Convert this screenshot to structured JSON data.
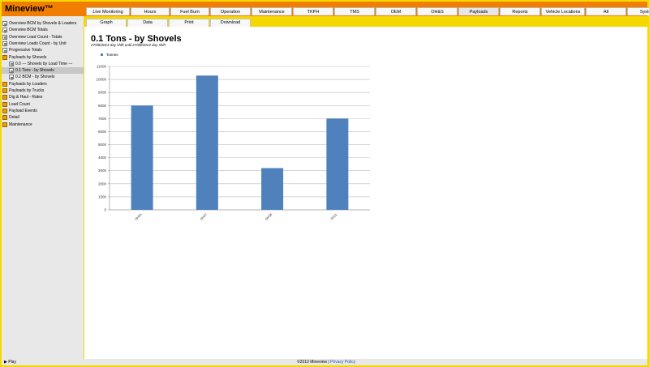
{
  "app": {
    "title": "Mineview™"
  },
  "tabs": [
    "Live Monitoring",
    "Hours",
    "Fuel Burn",
    "Operation",
    "Maintenance",
    "TKPH",
    "TMS",
    "OEM",
    "OH&S",
    "Payloads",
    "Reports",
    "Vehicle Locations",
    "All",
    "System"
  ],
  "active_tab": "Payloads",
  "subtabs": [
    "Graph",
    "Data",
    "Print",
    "Download"
  ],
  "sidebar": {
    "items": [
      {
        "label": "Overview BCM by Shovels & Loaders",
        "icon": "document-icon",
        "indent": 0
      },
      {
        "label": "Overview BCM Totals",
        "icon": "document-icon",
        "indent": 0
      },
      {
        "label": "Overview Load Count - Totals",
        "icon": "document-icon",
        "indent": 0
      },
      {
        "label": "Overview Loads Count - by Unit",
        "icon": "document-icon",
        "indent": 0
      },
      {
        "label": "Progressive Totals",
        "icon": "document-icon",
        "indent": 0
      },
      {
        "label": "Payloads by Shovels",
        "icon": "folder-icon",
        "indent": 0
      },
      {
        "label": "0.0 --- Shovels by Load Time ---",
        "icon": "document-icon",
        "indent": 1
      },
      {
        "label": "0.1 Tons - by Shovels",
        "icon": "document-icon",
        "indent": 1
      },
      {
        "label": "0.2 BCM - by Shovels",
        "icon": "document-icon",
        "indent": 1
      },
      {
        "label": "Payloads by Loaders",
        "icon": "folder-icon",
        "indent": 0
      },
      {
        "label": "Payloads by Trucks",
        "icon": "folder-icon",
        "indent": 0
      },
      {
        "label": "Dig & Haul - Rates",
        "icon": "folder-icon",
        "indent": 0
      },
      {
        "label": "Load Count",
        "icon": "folder-icon",
        "indent": 0
      },
      {
        "label": "Payload Events",
        "icon": "folder-icon",
        "indent": 0
      },
      {
        "label": "Detail",
        "icon": "folder-icon",
        "indent": 0
      },
      {
        "label": "Maintenance",
        "icon": "folder-icon",
        "indent": 0
      }
    ],
    "selected": "0.1 Tons - by Shovels"
  },
  "page": {
    "title": "0.1 Tons - by Shovels",
    "subtitle": "27/08/2014 day shift until 27/08/2014 day shift"
  },
  "colors": {
    "bar": "#4f81bd",
    "header": "#f17e00",
    "frame": "#f5d800"
  },
  "chart_data": {
    "type": "bar",
    "categories": [
      "SH05",
      "SH07",
      "SH08",
      "SH11"
    ],
    "series": [
      {
        "name": "Tonnes",
        "values": [
          8000,
          10300,
          3200,
          7000
        ]
      }
    ],
    "xlabel": "",
    "ylabel": "",
    "ylim": [
      0,
      11000
    ],
    "yticks": [
      0,
      1000,
      2000,
      3000,
      4000,
      5000,
      6000,
      7000,
      8000,
      9000,
      10000,
      11000
    ],
    "grid": true,
    "legend": "top-left"
  },
  "footer": {
    "play": "▶ Play",
    "copyright": "©2010 Mineview",
    "separator": " | ",
    "privacy": "Privacy Policy"
  }
}
